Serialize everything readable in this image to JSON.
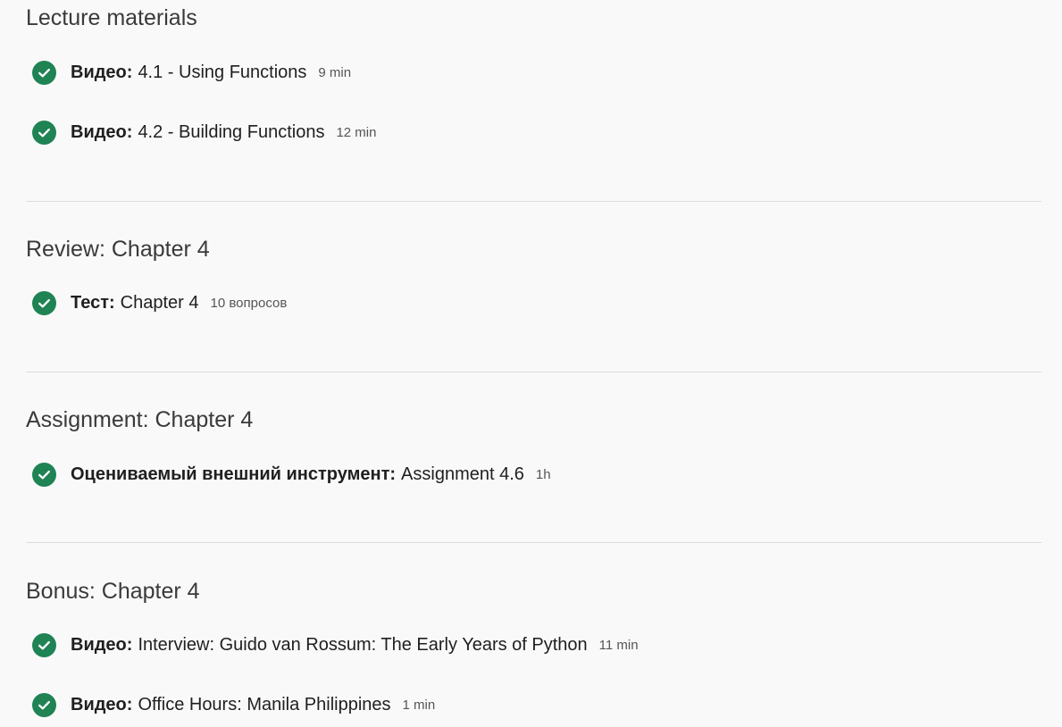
{
  "sections": [
    {
      "title": "Lecture materials",
      "items": [
        {
          "type": "Видео:",
          "name": "4.1 - Using Functions",
          "meta": "9 min"
        },
        {
          "type": "Видео:",
          "name": "4.2 - Building Functions",
          "meta": "12 min"
        }
      ]
    },
    {
      "title": "Review: Chapter 4",
      "items": [
        {
          "type": "Тест:",
          "name": "Chapter 4",
          "meta": "10 вопросов"
        }
      ]
    },
    {
      "title": "Assignment: Chapter 4",
      "items": [
        {
          "type": "Оцениваемый внешний инструмент:",
          "name": "Assignment 4.6",
          "meta": "1h"
        }
      ]
    },
    {
      "title": "Bonus: Chapter 4",
      "items": [
        {
          "type": "Видео:",
          "name": "Interview: Guido van Rossum: The Early Years of Python",
          "meta": "11 min"
        },
        {
          "type": "Видео:",
          "name": "Office Hours: Manila Philippines",
          "meta": "1 min"
        }
      ]
    }
  ],
  "icons": {
    "completed": "check-circle-icon"
  },
  "colors": {
    "completed_green": "#1f8354",
    "background": "#f9f9f9",
    "divider": "#dcdcdc"
  }
}
